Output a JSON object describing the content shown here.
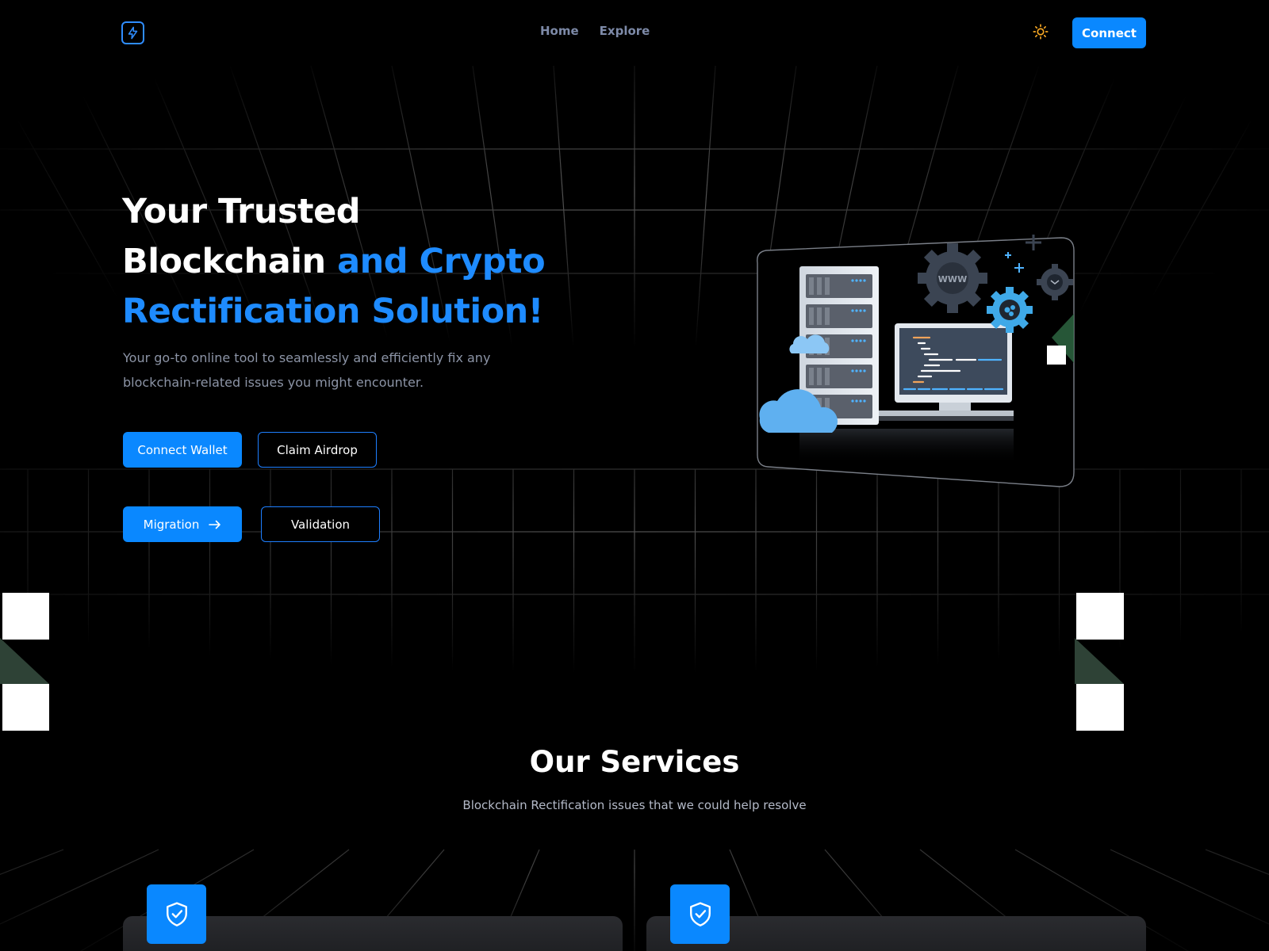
{
  "header": {
    "logo_icon": "lightning-bolt-icon",
    "nav": [
      {
        "label": "Home"
      },
      {
        "label": "Explore"
      }
    ],
    "theme_icon": "sun-icon",
    "connect_label": "Connect"
  },
  "hero": {
    "title_line1": "Your Trusted",
    "title_line2_white": "Blockchain",
    "title_line2_accent": "and Crypto",
    "title_line3_accent": "Rectification Solution!",
    "subtitle": "Your go-to online tool to seamlessly and efficiently fix any blockchain-related issues you might encounter.",
    "buttons": {
      "connect_wallet": "Connect Wallet",
      "claim_airdrop": "Claim Airdrop",
      "migration": "Migration",
      "validation": "Validation"
    },
    "illustration": {
      "badge_text": "WWW"
    }
  },
  "services": {
    "title": "Our Services",
    "subtitle": "Blockchain Rectification issues that we could help resolve",
    "cards": [
      {
        "icon": "shield-check-icon"
      },
      {
        "icon": "shield-check-icon"
      }
    ]
  },
  "colors": {
    "accent": "#0a88ff",
    "accent_text": "#1e8bff",
    "background": "#000000",
    "nav_text": "#7d8aa8"
  }
}
